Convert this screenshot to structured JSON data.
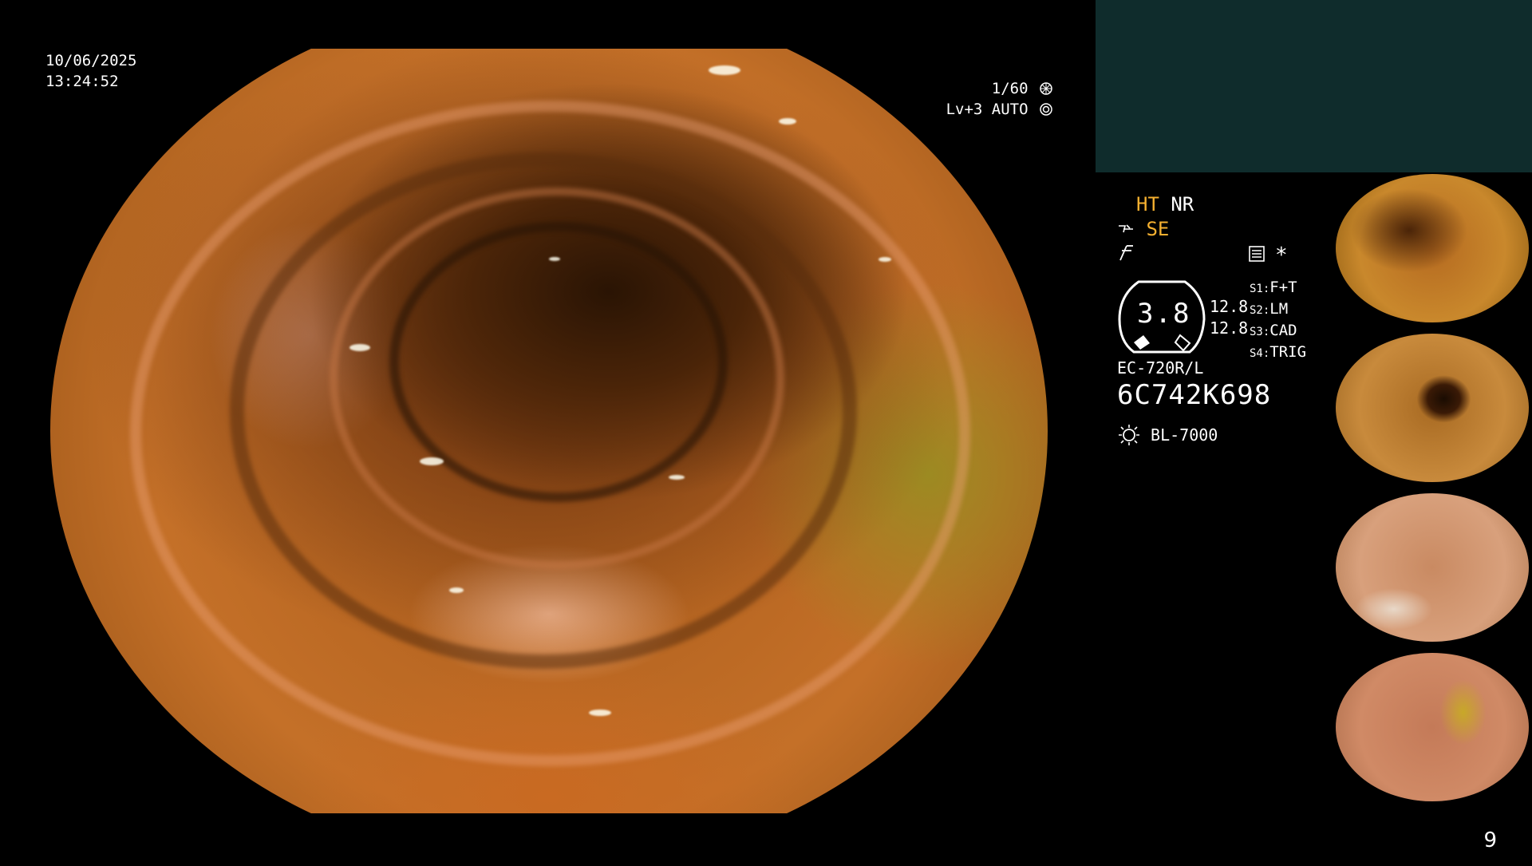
{
  "overlay": {
    "date": "10/06/2025",
    "time": "13:24:52",
    "shutter": "1/60",
    "level": "Lv+3",
    "mode": "AUTO"
  },
  "info": {
    "ht": "HT",
    "nr": "NR",
    "se": "SE",
    "dial_value": "3.8",
    "num_top": "12.8",
    "num_bottom": "12.8",
    "s_labels": [
      "S1:",
      "S2:",
      "S3:",
      "S4:"
    ],
    "s_values": [
      "F+T",
      "LM",
      "CAD",
      "TRIG"
    ],
    "scope_model": "EC-720R/L",
    "serial": "6C742K698",
    "light_source": "BL-7000"
  },
  "page_number": "9",
  "colors": {
    "accent_amber": "#f5b030",
    "header_teal": "#0f2c2c"
  },
  "icons": [
    "shutter-icon",
    "auto-iris-icon",
    "se-mode-icon",
    "freeze-icon",
    "settings-card-icon",
    "asterisk-icon",
    "light-source-icon"
  ]
}
